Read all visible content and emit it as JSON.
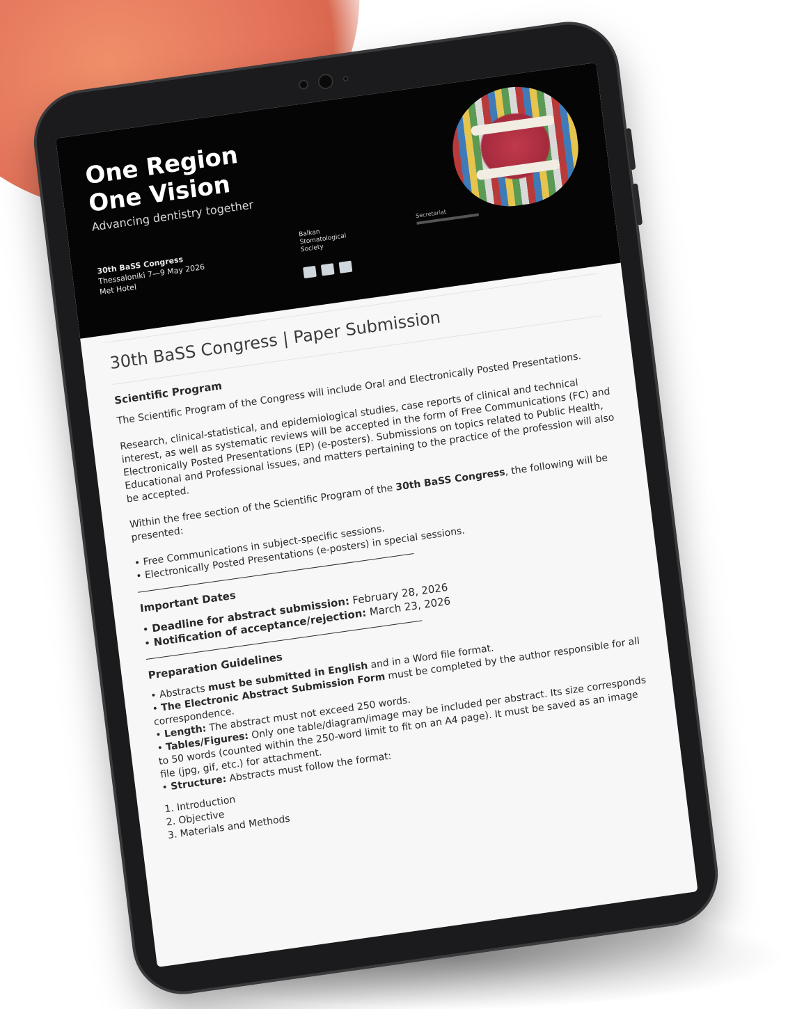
{
  "hero": {
    "title": "One Region\nOne Vision",
    "subtitle": "Advancing dentistry together",
    "event_name": "30th BaSS Congress",
    "event_place_date": "Thessaloniki 7—9 May 2026",
    "event_venue": "Met Hotel",
    "society": "Balkan\nStomatological\nSociety",
    "secretariat_label": "Secretariat"
  },
  "page_title": "30th BaSS Congress | Paper Submission",
  "scientific": {
    "heading": "Scientific Program",
    "p1": "The Scientific Program of the Congress will include Oral and Electronically Posted Presentations.",
    "p2": "Research, clinical-statistical, and epidemiological studies, case reports of clinical and technical interest, as well as systematic reviews will be accepted in the form of Free Communications (FC) and Electronically Posted Presentations (EP) (e-posters). Submissions on topics related to Public Health, Educational and Professional issues, and matters pertaining to the practice of the profession will also be accepted.",
    "p3_before": "Within the free section of the Scientific Program of the ",
    "p3_bold": "30th BaSS Congress",
    "p3_after": ", the following will be presented:",
    "items": [
      "Free Communications in subject-specific sessions.",
      "Electronically Posted Presentations (e-posters) in special sessions."
    ]
  },
  "dates": {
    "heading": "Important Dates",
    "d1_label": "Deadline for abstract submission:",
    "d1_value": " February 28, 2026",
    "d2_label": "Notification of acceptance/rejection:",
    "d2_value": " March 23, 2026"
  },
  "guidelines": {
    "heading": "Preparation Guidelines",
    "g1_a": "Abstracts ",
    "g1_b": "must be submitted in English",
    "g1_c": " and in a Word file format.",
    "g2_b": "The Electronic Abstract Submission Form",
    "g2_c": " must be completed by the author responsible for all correspondence.",
    "g3_b": "Length:",
    "g3_c": " The abstract must not exceed 250 words.",
    "g4_b": "Tables/Figures:",
    "g4_c": " Only one table/diagram/image may be included per abstract. Its size corresponds to 50 words (counted within the 250-word limit to fit on an A4 page). It must be saved as an image file (jpg, gif, etc.) for attachment.",
    "g5_b": "Structure:",
    "g5_c": " Abstracts must follow the format:",
    "structure": [
      "1. Introduction",
      "2. Objective",
      "3. Materials and Methods"
    ]
  }
}
